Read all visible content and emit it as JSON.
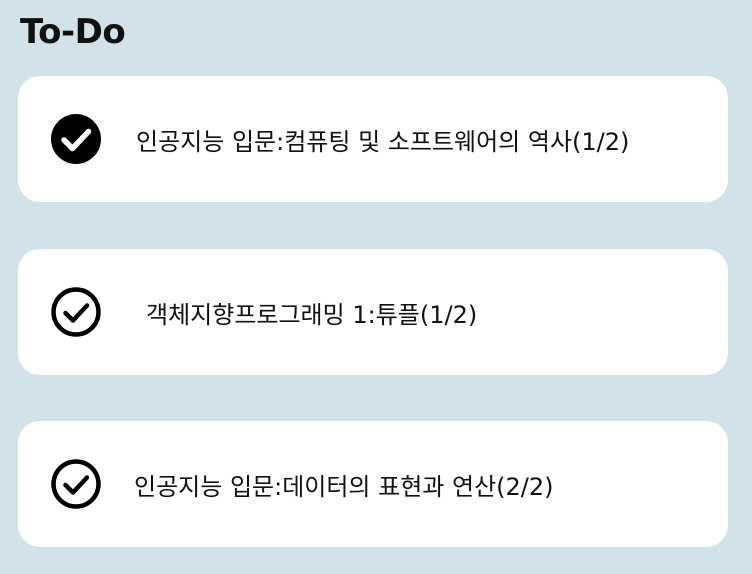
{
  "header": {
    "title": "To-Do"
  },
  "todos": [
    {
      "label": "인공지능 입문:컴퓨팅 및 소프트웨어의 역사(1/2)",
      "completed": true,
      "icon": "check-circle-filled-icon"
    },
    {
      "label": "객체지향프로그래밍 1:튜플(1/2)",
      "completed": false,
      "icon": "check-circle-outline-icon"
    },
    {
      "label": "인공지능 입문:데이터의 표현과 연산(2/2)",
      "completed": false,
      "icon": "check-circle-outline-icon"
    }
  ],
  "colors": {
    "background": "#d1e3e8",
    "card": "#ffffff",
    "text": "#111111"
  }
}
